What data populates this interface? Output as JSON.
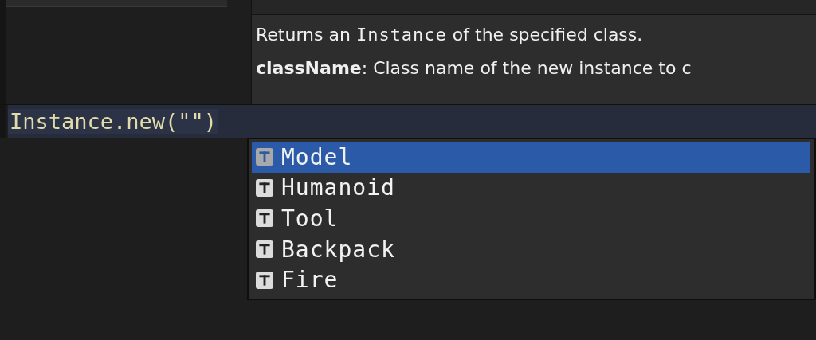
{
  "tooltip": {
    "summary": [
      {
        "kind": "text",
        "text": "Returns an "
      },
      {
        "kind": "code",
        "text": "Instance"
      },
      {
        "kind": "text",
        "text": " of the specified class."
      }
    ],
    "parameter": "**className**: Class name of the new instance to c"
  },
  "code_line": "Instance.new(\"\")",
  "completions": [
    {
      "label": "Model",
      "selected": true
    },
    {
      "label": "Humanoid",
      "selected": false
    },
    {
      "label": "Tool",
      "selected": false
    },
    {
      "label": "Backpack",
      "selected": false
    },
    {
      "label": "Fire",
      "selected": false
    }
  ]
}
